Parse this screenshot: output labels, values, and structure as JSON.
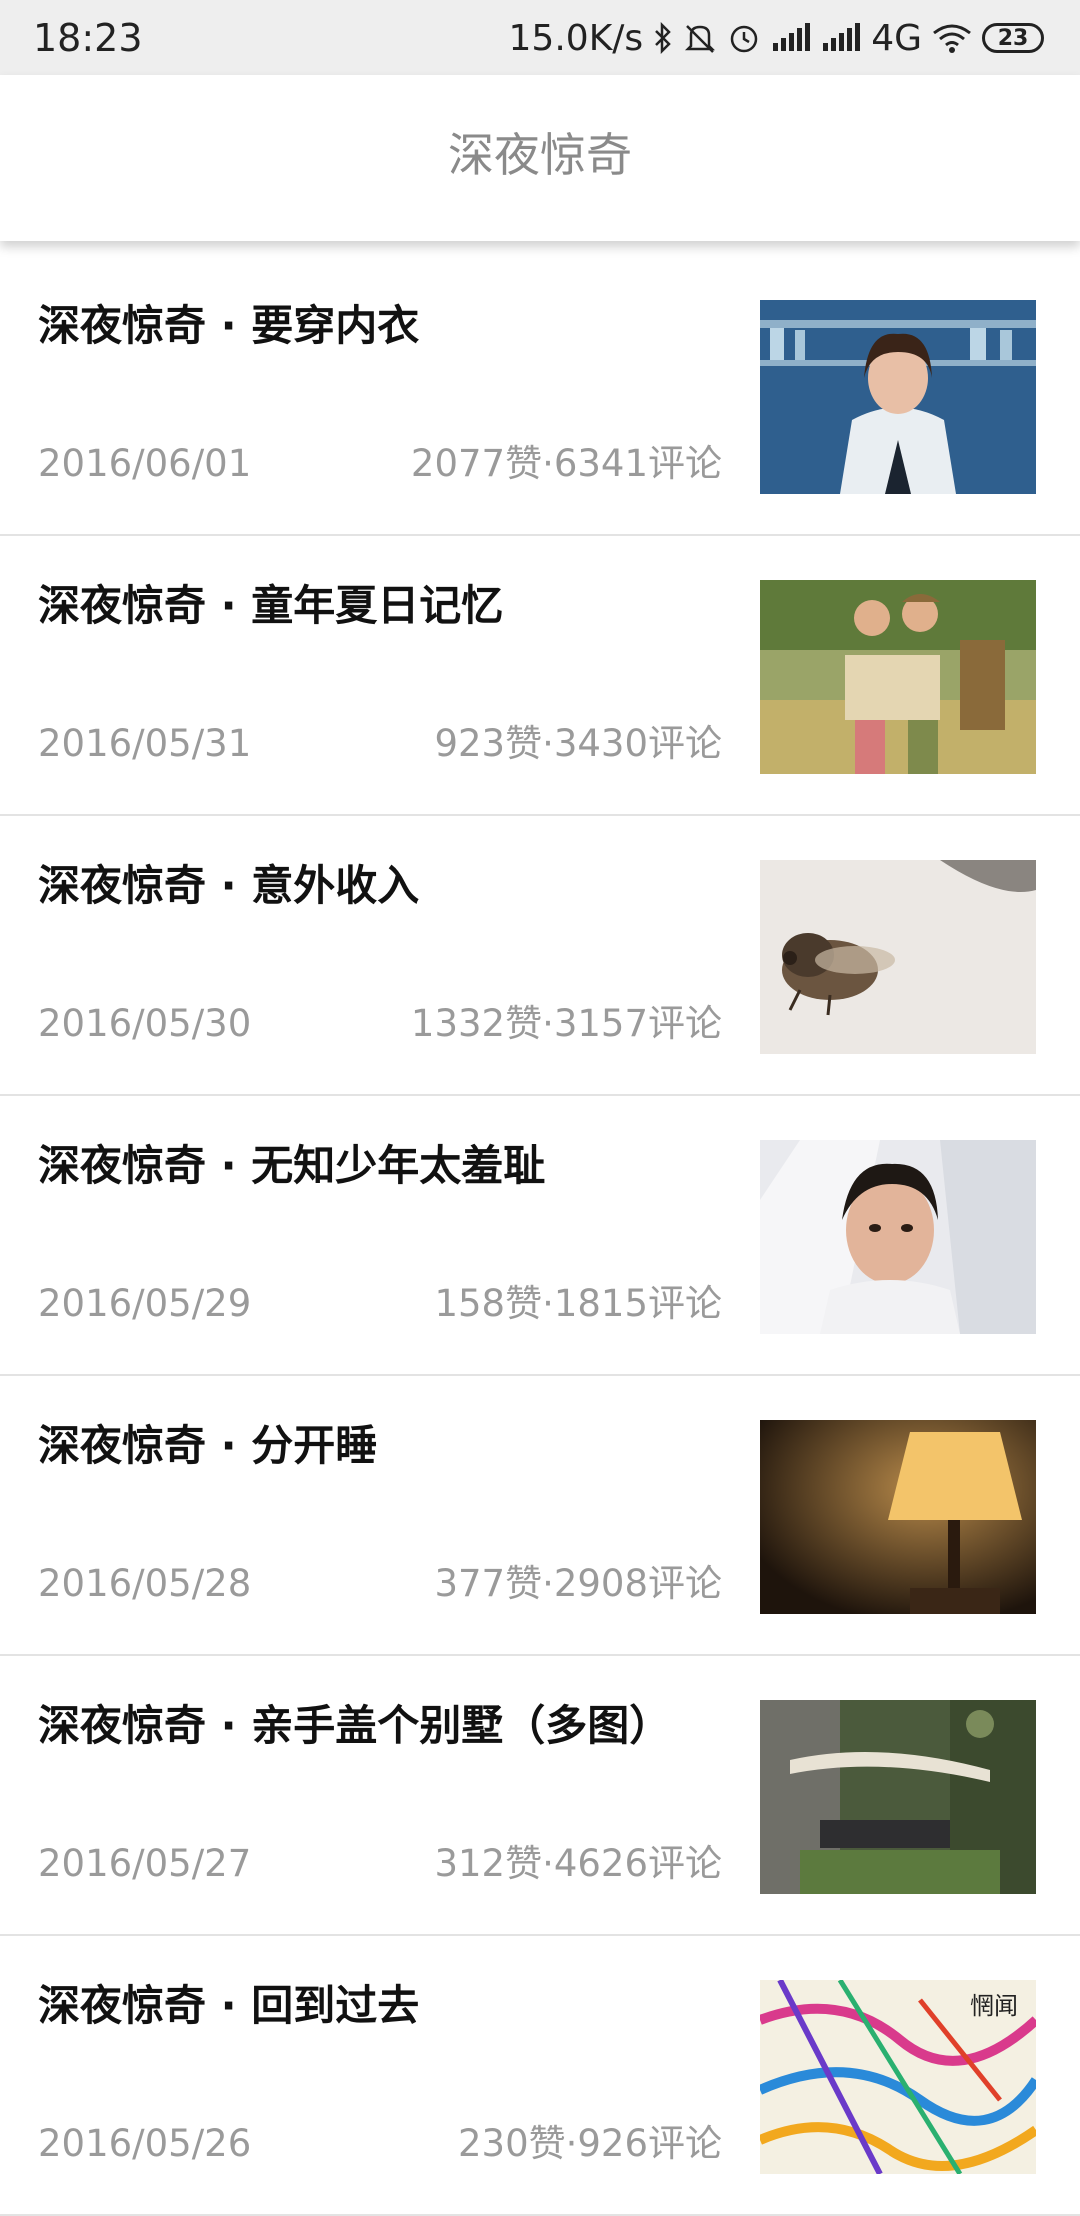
{
  "status_bar": {
    "time": "18:23",
    "net_speed": "15.0K/s",
    "network": "4G",
    "battery": "23",
    "icons": [
      "bluetooth-icon",
      "mute-icon",
      "alarm-icon",
      "signal-icon",
      "signal-icon",
      "wifi-icon"
    ]
  },
  "header": {
    "title": "深夜惊奇"
  },
  "articles": [
    {
      "title": "深夜惊奇 · 要穿内衣",
      "date": "2016/06/01",
      "stats": "2077赞·6341评论",
      "thumb": "woman-in-lab-photo"
    },
    {
      "title": "深夜惊奇 · 童年夏日记忆",
      "date": "2016/05/31",
      "stats": "923赞·3430评论",
      "thumb": "kids-with-map-photo"
    },
    {
      "title": "深夜惊奇 · 意外收入",
      "date": "2016/05/30",
      "stats": "1332赞·3157评论",
      "thumb": "cicada-photo"
    },
    {
      "title": "深夜惊奇 · 无知少年太羞耻",
      "date": "2016/05/29",
      "stats": "158赞·1815评论",
      "thumb": "girl-portrait-photo"
    },
    {
      "title": "深夜惊奇 · 分开睡",
      "date": "2016/05/28",
      "stats": "377赞·2908评论",
      "thumb": "lamp-photo"
    },
    {
      "title": "深夜惊奇 · 亲手盖个别墅（多图）",
      "date": "2016/05/27",
      "stats": "312赞·4626评论",
      "thumb": "garden-villa-photo"
    },
    {
      "title": "深夜惊奇 · 回到过去",
      "date": "2016/05/26",
      "stats": "230赞·926评论",
      "thumb": "colorful-art-photo",
      "thumb_text": "惘闻"
    }
  ]
}
